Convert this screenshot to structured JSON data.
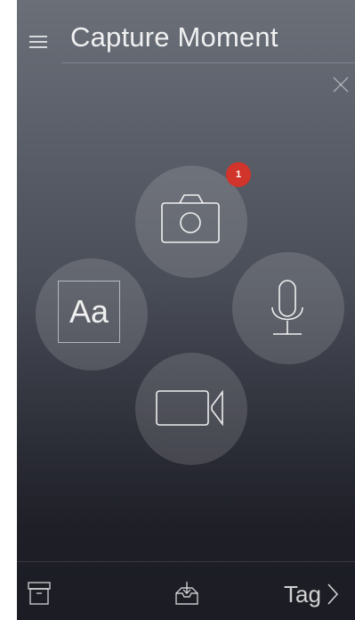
{
  "header": {
    "title": "Capture Moment",
    "menu_icon": "hamburger-menu-icon",
    "close_icon": "close-icon"
  },
  "capture_options": {
    "photo": {
      "icon": "camera-icon",
      "badge_count": "1"
    },
    "text": {
      "icon": "text-icon",
      "label": "Aa"
    },
    "audio": {
      "icon": "microphone-icon"
    },
    "video": {
      "icon": "video-camera-icon"
    }
  },
  "footer": {
    "archive_icon": "archive-icon",
    "inbox_icon": "inbox-download-icon",
    "tag_label": "Tag",
    "tag_icon": "chevron-right-icon"
  },
  "colors": {
    "badge": "#d1342a",
    "background_top": "#6a6f78",
    "background_bottom": "#1b1c24"
  }
}
